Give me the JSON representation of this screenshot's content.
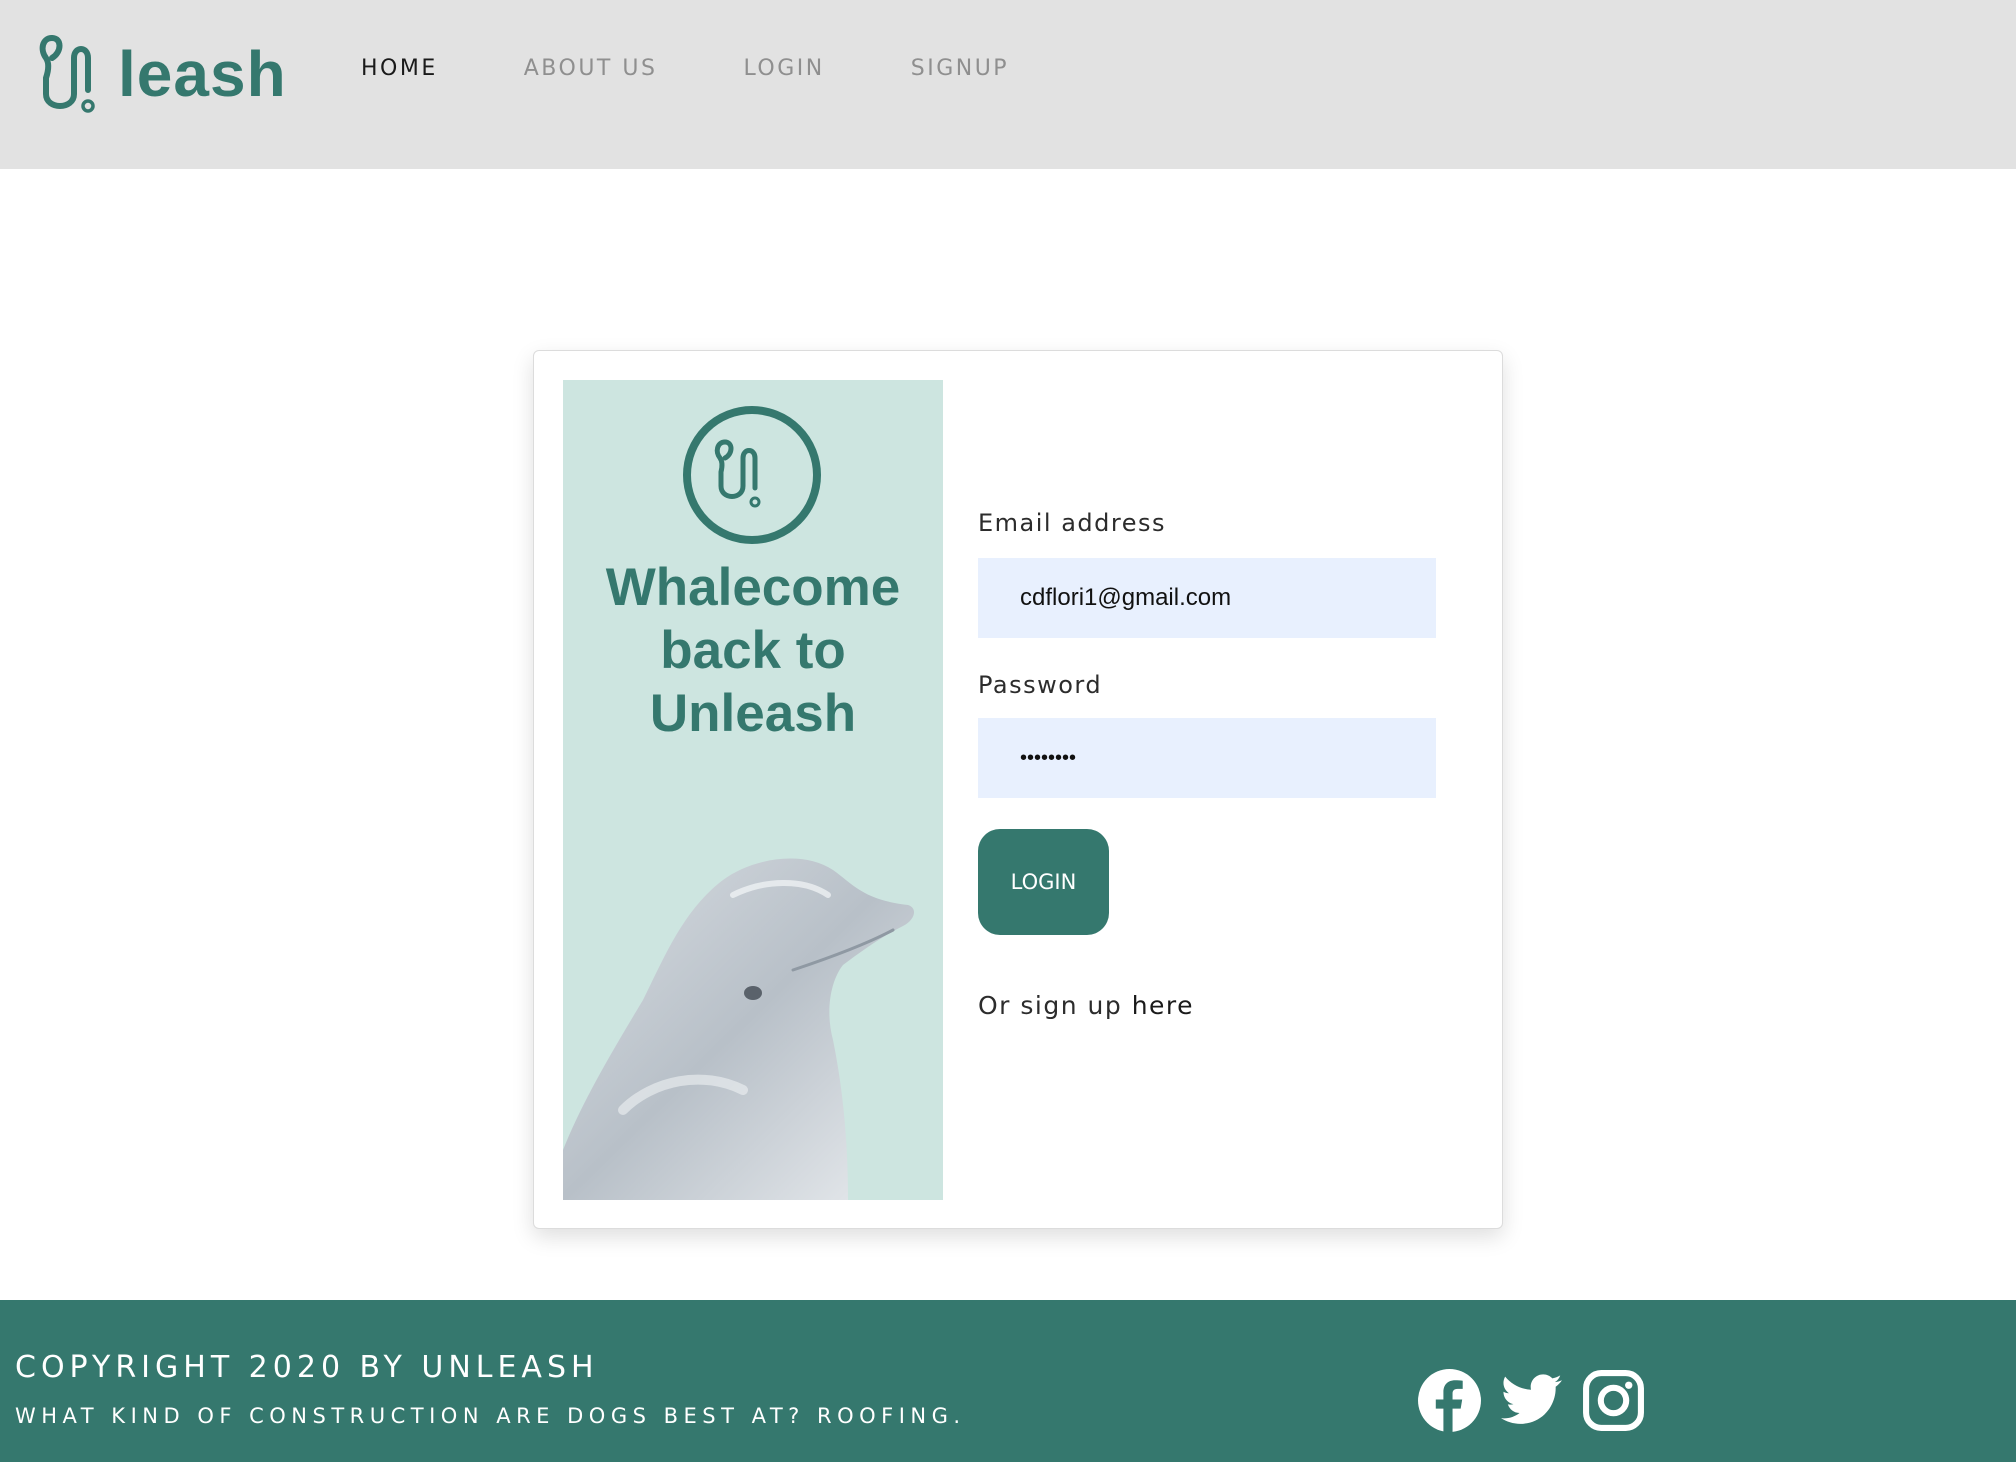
{
  "header": {
    "logo_text": "leash",
    "nav": [
      {
        "label": "HOME",
        "active": true
      },
      {
        "label": "ABOUT US",
        "active": false
      },
      {
        "label": "LOGIN",
        "active": false
      },
      {
        "label": "SIGNUP",
        "active": false
      }
    ]
  },
  "panel": {
    "title_line1": "Whalecome",
    "title_line2": "back to",
    "title_line3": "Unleash"
  },
  "form": {
    "email_label": "Email address",
    "email_value": "cdflori1@gmail.com",
    "password_label": "Password",
    "password_value": "••••••••",
    "login_button": "LOGIN",
    "signup_prefix": "Or sign up ",
    "signup_link": "here"
  },
  "footer": {
    "copyright": "COPYRIGHT 2020 BY UNLEASH",
    "joke": "WHAT KIND OF CONSTRUCTION ARE DOGS BEST AT? ROOFING.",
    "social_icons": [
      "facebook-icon",
      "twitter-icon",
      "instagram-icon"
    ]
  },
  "colors": {
    "brand": "#35786e",
    "panel_bg": "#cde5e0",
    "header_bg": "#e2e2e2",
    "input_bg": "#e8f0fe"
  }
}
